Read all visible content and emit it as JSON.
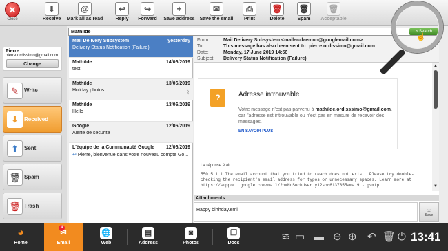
{
  "toolbar": {
    "close": "Close",
    "buttons": [
      {
        "label": "Receive",
        "icon": "receive-icon",
        "glyph": "⬇"
      },
      {
        "label": "Mark all as read",
        "icon": "mark-read-icon",
        "glyph": "@"
      },
      {
        "label": "Reply",
        "icon": "reply-icon",
        "glyph": "↩"
      },
      {
        "label": "Forward",
        "icon": "forward-icon",
        "glyph": "↪"
      },
      {
        "label": "Save address",
        "icon": "save-address-icon",
        "glyph": "+"
      },
      {
        "label": "Save the email",
        "icon": "save-email-icon",
        "glyph": "✉"
      },
      {
        "label": "Print",
        "icon": "print-icon",
        "glyph": "⎙"
      },
      {
        "label": "Delete",
        "icon": "delete-icon",
        "glyph": "🗑"
      },
      {
        "label": "Spam",
        "icon": "spam-icon",
        "glyph": "🗑"
      },
      {
        "label": "Acceptable",
        "icon": "acceptable-icon",
        "glyph": "🗑"
      }
    ]
  },
  "search": {
    "value": "Mathilde",
    "button": "Search"
  },
  "user": {
    "name": "Pierre",
    "email": "pierre.ordissimo@gmail.com",
    "change": "Change"
  },
  "nav": [
    {
      "label": "Write",
      "icon": "write-icon",
      "color": "#c03030",
      "glyph": "✎"
    },
    {
      "label": "Received",
      "icon": "inbox-icon",
      "color": "#ffffff",
      "glyph": "⬇"
    },
    {
      "label": "Sent",
      "icon": "sent-icon",
      "color": "#3a7bc8",
      "glyph": "⬆"
    },
    {
      "label": "Spam",
      "icon": "spam-folder-icon",
      "color": "#333333",
      "glyph": "🗑"
    },
    {
      "label": "Trash",
      "icon": "trash-icon",
      "color": "#cc2222",
      "glyph": "🗑"
    }
  ],
  "messages": [
    {
      "from": "Mail Delivery Subsystem",
      "date": "yesterday",
      "subject": "Delivery Status Notification (Failure)"
    },
    {
      "from": "Mathilde",
      "date": "14/06/2019",
      "subject": "test"
    },
    {
      "from": "Mathilde",
      "date": "13/06/2019",
      "subject": "Holiday photos"
    },
    {
      "from": "Mathilde",
      "date": "13/06/2019",
      "subject": "Hello"
    },
    {
      "from": "Google",
      "date": "12/06/2019",
      "subject": "Alerte de sécurité"
    },
    {
      "from": "L'équipe de la Communauté Google",
      "date": "12/06/2019",
      "subject": "Pierre, bienvenue dans votre nouveau compte Go..."
    }
  ],
  "header": {
    "from_label": "From:",
    "from": "Mail Delivery Subsystem <mailer-daemon@googlemail.com>",
    "to_label": "To:",
    "to": "This message has also been sent to: pierre.ordissimo@gmail.com",
    "date_label": "Date:",
    "date": "Monday, 17 June 2019 14:56",
    "subject_label": "Subject:",
    "subject": "Delivery Status Notification (Failure)"
  },
  "body": {
    "title": "Adresse introuvable",
    "p1": "Votre message n'est pas parvenu à",
    "p_email": "mathilde.ordisssimo@gmail.com",
    "p2": ", car l'adresse est introuvable ou n'est pas en mesure de recevoir des messages.",
    "more": "EN SAVOIR PLUS",
    "response_label": "La réponse était :",
    "code": "550 5.1.1 The email account that you tried to reach does not exist. Please try double-checking the recipient's email address for typos or unnecessary spaces. Learn more at https://support.google.com/mail/?p=NoSuchUser y12sor6137855wma.9 - gsmtp"
  },
  "attachments": {
    "label": "Attachments:",
    "file": "Happy birthday.eml",
    "save": "Save"
  },
  "taskbar": {
    "items": [
      {
        "label": "Home",
        "icon": "home-icon",
        "glyph": "◕"
      },
      {
        "label": "Email",
        "icon": "email-icon",
        "glyph": "✉",
        "badge": "4"
      },
      {
        "label": "Web",
        "icon": "web-icon",
        "glyph": "🌐"
      },
      {
        "label": "Address",
        "icon": "address-icon",
        "glyph": "▤"
      },
      {
        "label": "Photos",
        "icon": "photos-icon",
        "glyph": "◙"
      },
      {
        "label": "Docs",
        "icon": "docs-icon",
        "glyph": "❐"
      }
    ],
    "time": "13:41"
  }
}
